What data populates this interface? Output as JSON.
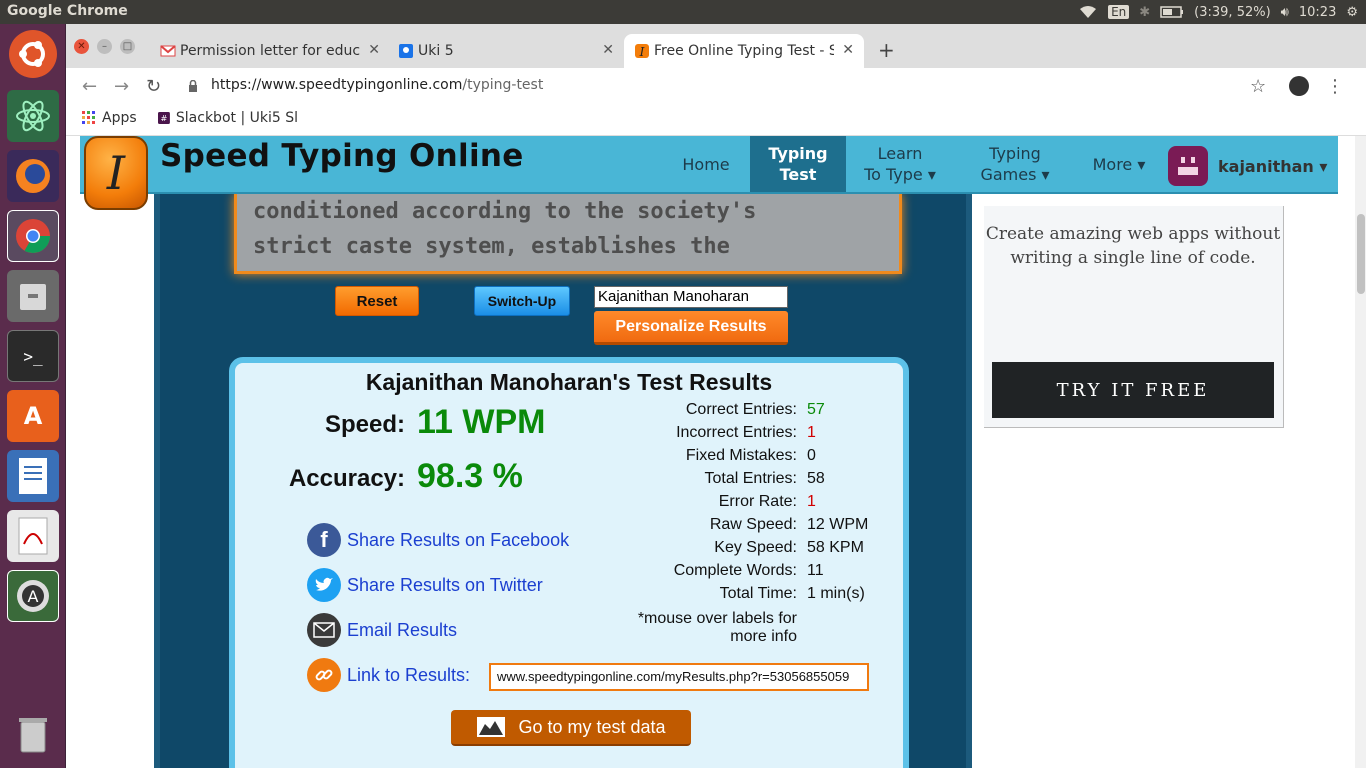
{
  "os": {
    "app_title": "Google Chrome",
    "keyboard": "En",
    "battery": "(3:39, 52%)",
    "clock": "10:23"
  },
  "browser": {
    "tabs": [
      {
        "title": "Permission letter for educ"
      },
      {
        "title": "Uki 5"
      },
      {
        "title": "Free Online Typing Test - S"
      }
    ],
    "url_host": "https://www.speedtypingonline.com",
    "url_path": "/typing-test",
    "bookmarks": [
      {
        "label": "Apps"
      },
      {
        "label": "Slackbot | Uki5 Sl"
      }
    ]
  },
  "site": {
    "name": "Speed Typing Online",
    "logo_letter": "I",
    "menu": [
      {
        "line1": "Home",
        "line2": ""
      },
      {
        "line1": "Typing",
        "line2": "Test"
      },
      {
        "line1": "Learn",
        "line2": "To Type ▾"
      },
      {
        "line1": "Typing",
        "line2": "Games ▾"
      },
      {
        "line1": "More ▾",
        "line2": ""
      }
    ],
    "username": "kajanithan ▾"
  },
  "test": {
    "passage_line1": "conditioned according to the society's",
    "passage_line2": "strict caste system, establishes the",
    "reset_label": "Reset",
    "switch_label": "Switch-Up",
    "name_value": "Kajanithan Manoharan",
    "personalize_label": "Personalize Results"
  },
  "results": {
    "title": "Kajanithan Manoharan's Test Results",
    "speed_label": "Speed:",
    "speed_value": "11 WPM",
    "accuracy_label": "Accuracy:",
    "accuracy_value": "98.3 %",
    "stats": [
      {
        "label": "Correct Entries:",
        "value": "57"
      },
      {
        "label": "Incorrect Entries:",
        "value": "1"
      },
      {
        "label": "Fixed Mistakes:",
        "value": "0"
      },
      {
        "label": "Total Entries:",
        "value": "58"
      },
      {
        "label": "Error Rate:",
        "value": "1"
      },
      {
        "label": "Raw Speed:",
        "value": "12 WPM"
      },
      {
        "label": "Key Speed:",
        "value": "58 KPM"
      },
      {
        "label": "Complete Words:",
        "value": "11"
      },
      {
        "label": "Total Time:",
        "value": "1 min(s)"
      }
    ],
    "note": "*mouse over labels for more info",
    "share_facebook": "Share Results on Facebook",
    "share_twitter": "Share Results on Twitter",
    "email": "Email Results",
    "link_label": "Link to Results:",
    "link_value": "www.speedtypingonline.com/myResults.php?r=53056855059",
    "test_data_label": "Go to my test data"
  },
  "ad": {
    "text": "Create amazing web apps without writing a single line of code.",
    "button": "TRY IT FREE"
  }
}
